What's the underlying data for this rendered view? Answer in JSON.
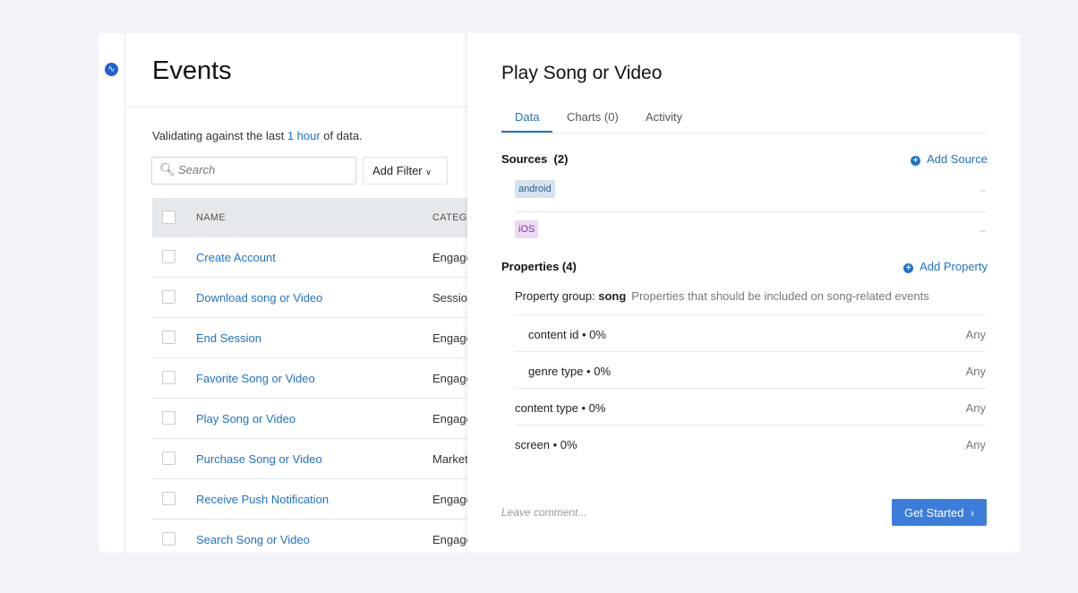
{
  "app": {
    "logo_icon": "amplitude-logo-icon"
  },
  "left": {
    "title": "Events",
    "validating_prefix": "Validating against the last ",
    "validating_link": "1 hour",
    "validating_suffix": " of data.",
    "search_placeholder": "Search",
    "filter_label": "Add Filter",
    "columns": {
      "name": "NAME",
      "category": "CATEGORY"
    },
    "rows": [
      {
        "name": "Create Account",
        "category": "Engagement"
      },
      {
        "name": "Download song or Video",
        "category": "Session"
      },
      {
        "name": "End Session",
        "category": "Engagement"
      },
      {
        "name": "Favorite Song or Video",
        "category": "Engagement"
      },
      {
        "name": "Play  Song or Video",
        "category": "Engagement"
      },
      {
        "name": "Purchase Song or Video",
        "category": "Marketing"
      },
      {
        "name": "Receive Push Notification",
        "category": "Engagement"
      },
      {
        "name": "Search Song or Video",
        "category": "Engagement"
      }
    ]
  },
  "right": {
    "title": "Play Song or Video",
    "tabs": [
      "Data",
      "Charts (0)",
      "Activity"
    ],
    "sources_label": "Sources",
    "sources_count": "(2)",
    "add_source": "Add Source",
    "sources": [
      {
        "name": "android",
        "value": "–",
        "bg": "#d5e3ee",
        "color": "#2a5d8a"
      },
      {
        "name": "iOS",
        "value": "–",
        "bg": "#ecd9f2",
        "color": "#8a36b3"
      }
    ],
    "properties_label": "Properties (4)",
    "add_property": "Add Property",
    "group_label": "Property group: ",
    "group_name": "song",
    "group_desc": "Properties that should be included on song-related events",
    "properties": [
      {
        "name": "content id • 0%",
        "type": "Any",
        "nested": true
      },
      {
        "name": "genre type • 0%",
        "type": "Any",
        "nested": true
      },
      {
        "name": "content type • 0%",
        "type": "Any",
        "nested": false
      },
      {
        "name": "screen • 0%",
        "type": "Any",
        "nested": false
      }
    ],
    "comment_placeholder": "Leave comment...",
    "get_started": "Get Started"
  },
  "colors": {
    "accent": "#1e73c8",
    "button": "#3c7ddc",
    "background": "#f1f3f8"
  }
}
